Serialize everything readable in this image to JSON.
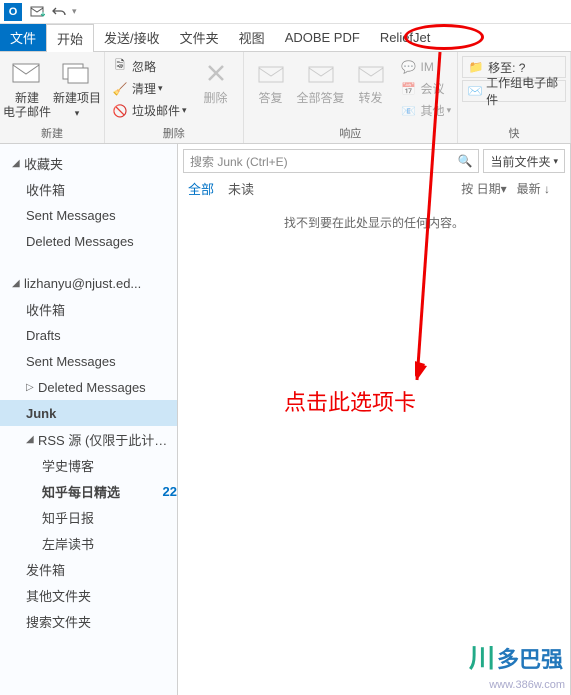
{
  "titlebar": {
    "app_abbrev": "O"
  },
  "tabs": {
    "file": "文件",
    "home": "开始",
    "sendreceive": "发送/接收",
    "folder": "文件夹",
    "view": "视图",
    "adobepdf": "ADOBE PDF",
    "reliefjet": "ReliefJet"
  },
  "ribbon": {
    "new_group": "新建",
    "new_mail": "新建\n电子邮件",
    "new_item": "新建项目",
    "delete_group": "删除",
    "ignore": "忽略",
    "cleanup": "清理",
    "junk": "垃圾邮件",
    "delete": "删除",
    "respond_group": "响应",
    "reply": "答复",
    "reply_all": "全部答复",
    "forward": "转发",
    "im": "IM",
    "meeting": "会议",
    "more": "其他",
    "quicksteps_group": "快",
    "moveto": "移至: ?",
    "team_mail": "工作组电子邮件"
  },
  "nav": {
    "favorites": "收藏夹",
    "inbox": "收件箱",
    "sent": "Sent Messages",
    "deleted": "Deleted Messages",
    "account": "lizhanyu@njust.ed...",
    "drafts": "Drafts",
    "junk": "Junk",
    "rss": "RSS 源 (仅限于此计算...",
    "rss1": "学史博客",
    "rss2": "知乎每日精选",
    "rss2_count": "22",
    "rss3": "知乎日报",
    "rss4": "左岸读书",
    "outbox": "发件箱",
    "other": "其他文件夹",
    "search_folders": "搜索文件夹"
  },
  "list": {
    "search_placeholder": "搜索 Junk (Ctrl+E)",
    "scope": "当前文件夹",
    "all": "全部",
    "unread": "未读",
    "by": "按",
    "date": "日期",
    "newest": "最新",
    "empty": "找不到要在此处显示的任何内容。"
  },
  "annotation": {
    "text": "点击此选项卡"
  },
  "watermark": {
    "url": "www.386w.com",
    "text": "多巴强"
  }
}
